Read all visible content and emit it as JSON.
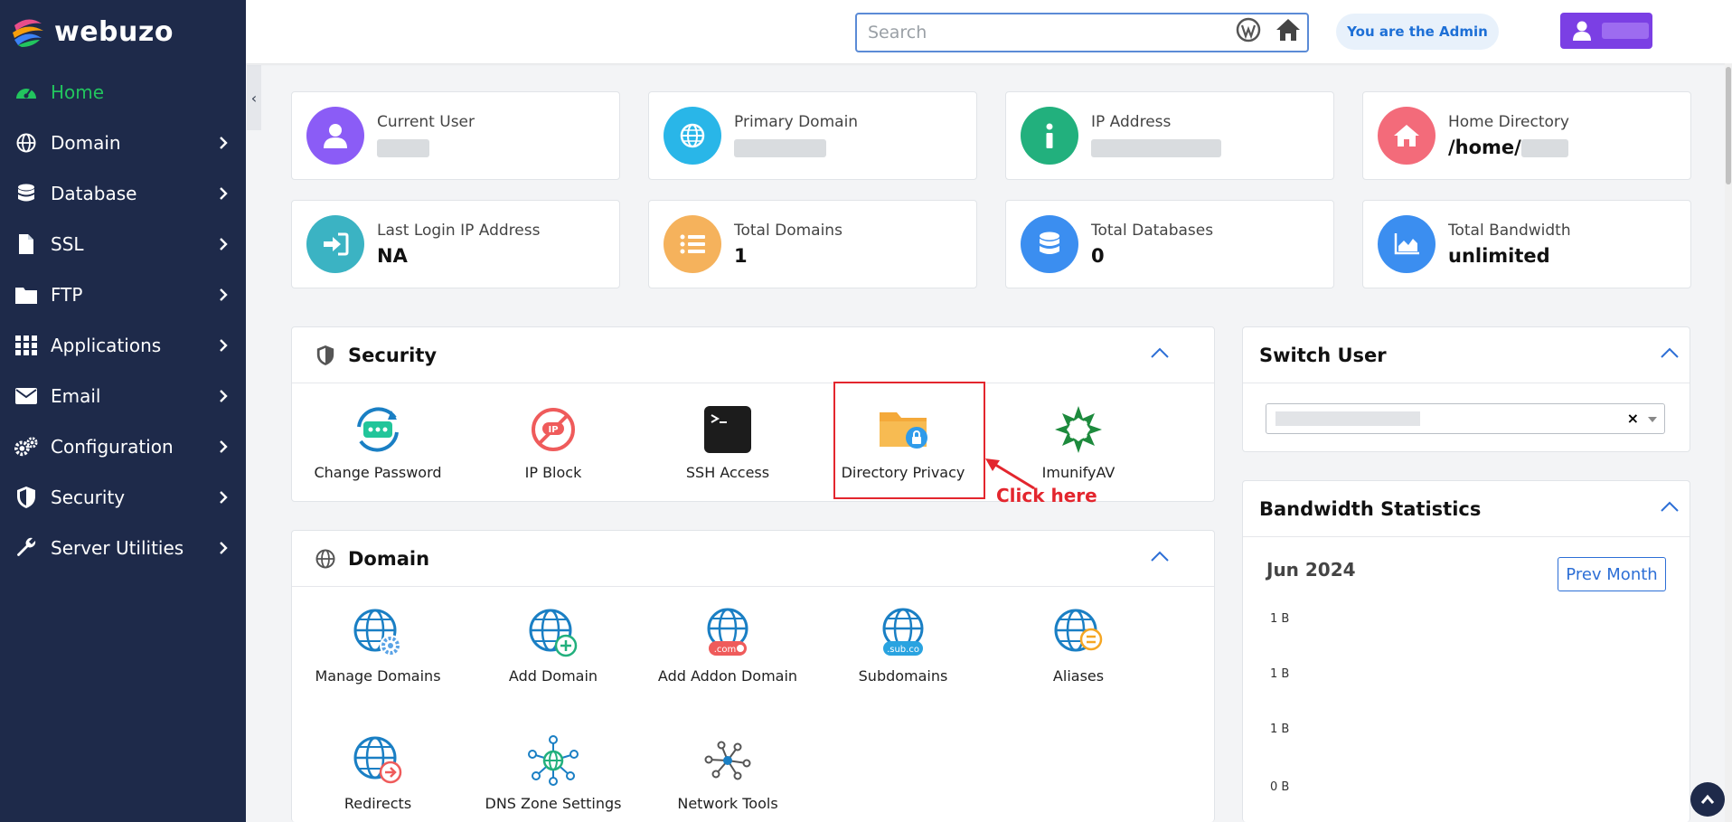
{
  "brand": {
    "name": "webuzo"
  },
  "sidebar": {
    "items": [
      {
        "label": "Home",
        "icon": "dashboard-icon",
        "active": true,
        "has_children": false
      },
      {
        "label": "Domain",
        "icon": "globe-icon",
        "has_children": true
      },
      {
        "label": "Database",
        "icon": "database-icon",
        "has_children": true
      },
      {
        "label": "SSL",
        "icon": "file-icon",
        "has_children": true
      },
      {
        "label": "FTP",
        "icon": "folder-icon",
        "has_children": true
      },
      {
        "label": "Applications",
        "icon": "grid-icon",
        "has_children": true
      },
      {
        "label": "Email",
        "icon": "envelope-icon",
        "has_children": true
      },
      {
        "label": "Configuration",
        "icon": "gears-icon",
        "has_children": true
      },
      {
        "label": "Security",
        "icon": "shield-icon",
        "has_children": true
      },
      {
        "label": "Server Utilities",
        "icon": "wrench-icon",
        "has_children": true
      }
    ],
    "collapse_label": "‹"
  },
  "topbar": {
    "search_placeholder": "Search",
    "admin_label": "You are the Admin"
  },
  "stats": {
    "current_user": {
      "label": "Current User",
      "value": ""
    },
    "primary_domain": {
      "label": "Primary Domain",
      "value": ""
    },
    "ip_address": {
      "label": "IP Address",
      "value": ""
    },
    "home_directory": {
      "label": "Home Directory",
      "value": "/home/"
    },
    "last_login_ip": {
      "label": "Last Login IP Address",
      "value": "NA"
    },
    "total_domains": {
      "label": "Total Domains",
      "value": "1"
    },
    "total_databases": {
      "label": "Total Databases",
      "value": "0"
    },
    "total_bandwidth": {
      "label": "Total Bandwidth",
      "value": "unlimited"
    }
  },
  "security_panel": {
    "title": "Security",
    "tiles": [
      {
        "label": "Change Password",
        "icon": "change-password-icon"
      },
      {
        "label": "IP Block",
        "icon": "ip-block-icon"
      },
      {
        "label": "SSH Access",
        "icon": "terminal-icon"
      },
      {
        "label": "Directory Privacy",
        "icon": "folder-lock-icon"
      },
      {
        "label": "ImunifyAV",
        "icon": "imunify-icon"
      }
    ],
    "annotation": "Click here"
  },
  "domain_panel": {
    "title": "Domain",
    "tiles": [
      {
        "label": "Manage Domains",
        "icon": "globe-gear-icon"
      },
      {
        "label": "Add Domain",
        "icon": "globe-plus-icon"
      },
      {
        "label": "Add Addon Domain",
        "icon": "globe-com-icon",
        "badge": ".com"
      },
      {
        "label": "Subdomains",
        "icon": "globe-sub-icon",
        "badge": ".sub.co"
      },
      {
        "label": "Aliases",
        "icon": "globe-equal-icon"
      },
      {
        "label": "Redirects",
        "icon": "globe-arrow-icon"
      },
      {
        "label": "DNS Zone Settings",
        "icon": "dns-network-icon"
      },
      {
        "label": "Network Tools",
        "icon": "network-icon"
      }
    ]
  },
  "switch_user": {
    "title": "Switch User",
    "clear": "×"
  },
  "bandwidth": {
    "title": "Bandwidth Statistics",
    "month": "Jun 2024",
    "prev_button": "Prev Month",
    "y_ticks": [
      "1 B",
      "1 B",
      "1 B",
      "0 B"
    ]
  },
  "colors": {
    "sidebar_bg": "#1e2a4a",
    "accent_green": "#22c55e",
    "accent_purple": "#7b3fe4",
    "annotation_red": "#e3262e"
  }
}
